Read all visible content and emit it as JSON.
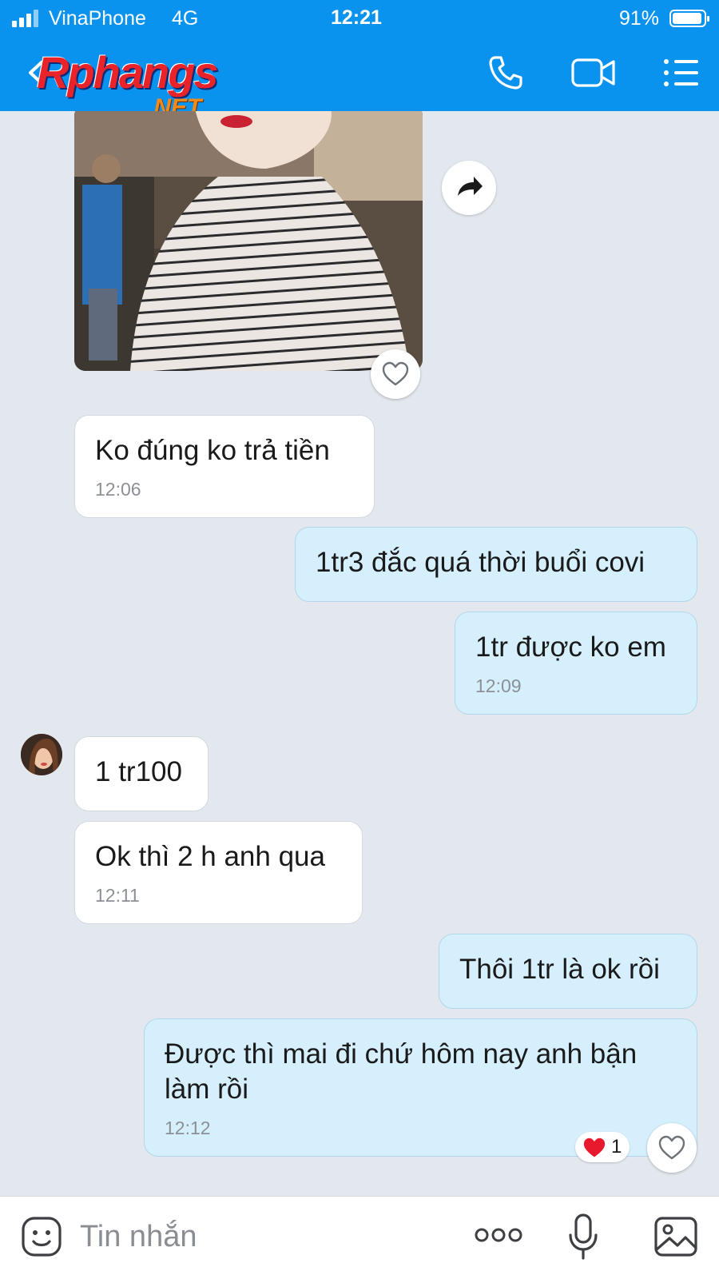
{
  "status": {
    "carrier": "VinaPhone",
    "network": "4G",
    "time": "12:21",
    "battery": "91%"
  },
  "header": {
    "logo_main": "Rphangs",
    "logo_sub": ".NET"
  },
  "messages": [
    {
      "side": "in",
      "text": "Ko đúng ko trả tiền",
      "time": "12:06"
    },
    {
      "side": "out",
      "text": "1tr3 đắc quá thời buổi covi",
      "time": ""
    },
    {
      "side": "out",
      "text": "1tr được ko em",
      "time": "12:09"
    },
    {
      "side": "in",
      "text": "1 tr100",
      "time": ""
    },
    {
      "side": "in",
      "text": "Ok thì 2 h anh qua",
      "time": "12:11"
    },
    {
      "side": "out",
      "text": "Thôi 1tr là ok rồi",
      "time": ""
    },
    {
      "side": "out",
      "text": "Được thì mai đi chứ hôm nay anh bận làm rồi",
      "time": "12:12"
    }
  ],
  "reaction": {
    "icon": "heart-icon",
    "count": "1"
  },
  "input": {
    "placeholder": "Tin nhắn"
  },
  "colors": {
    "header": "#0a93ee",
    "chat_bg": "#e3e8ef",
    "incoming": "#ffffff",
    "outgoing": "#d5effd",
    "reaction_heart": "#e8192c"
  }
}
